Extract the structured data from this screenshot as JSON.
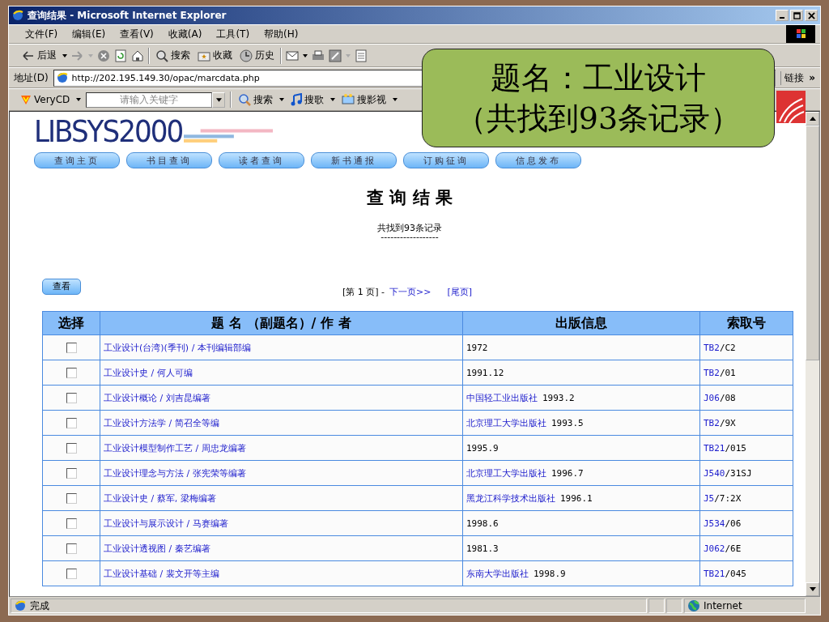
{
  "window": {
    "title": "查询结果 - Microsoft Internet Explorer"
  },
  "menu": [
    "文件(F)",
    "编辑(E)",
    "查看(V)",
    "收藏(A)",
    "工具(T)",
    "帮助(H)"
  ],
  "toolbar": {
    "back": "后退",
    "search": "搜索",
    "favorites": "收藏",
    "history": "历史"
  },
  "address": {
    "label": "地址(D)",
    "value": "http://202.195.149.30/opac/marcdata.php",
    "links": "链接",
    "more": "»"
  },
  "verycd": {
    "brand": "VeryCD",
    "placeholder": "请输入关键字",
    "search": "搜索",
    "music": "搜歌",
    "video": "搜影视"
  },
  "callout": {
    "line_1": "题名：工业设计",
    "line_2": "（共找到93条记录）"
  },
  "site": {
    "logo": "LIBSYS2000",
    "nav": [
      "查询主页",
      "书目查询",
      "读者查询",
      "新书通报",
      "订购征询",
      "信息发布"
    ]
  },
  "heading": "查 询 结 果",
  "count": "共找到93条记录",
  "rule": "------------------",
  "view_button": "查看",
  "pager": {
    "current": "[第 1 页] -",
    "next": "下一页>>",
    "last": "[尾页]"
  },
  "table": {
    "columns": [
      "选择",
      "题 名 （副题名）/ 作 者",
      "出版信息",
      "索取号"
    ],
    "rows": [
      {
        "checked": false,
        "title": "工业设计(台湾)(季刊) / 本刊编辑部编",
        "publisher": "",
        "year": "1972",
        "call_class": "TB2",
        "call_rest": "/C2"
      },
      {
        "checked": false,
        "title": "工业设计史 / 何人可编",
        "publisher": "",
        "year": "1991.12",
        "call_class": "TB2",
        "call_rest": "/01"
      },
      {
        "checked": false,
        "title": "工业设计概论 / 刘吉昆编著",
        "publisher": "中国轻工业出版社",
        "year": "1993.2",
        "call_class": "J06",
        "call_rest": "/08"
      },
      {
        "checked": false,
        "title": "工业设计方法学 / 简召全等编",
        "publisher": "北京理工大学出版社",
        "year": "1993.5",
        "call_class": "TB2",
        "call_rest": "/9X"
      },
      {
        "checked": false,
        "title": "工业设计模型制作工艺 / 周忠龙编著",
        "publisher": "",
        "year": "1995.9",
        "call_class": "TB21",
        "call_rest": "/015"
      },
      {
        "checked": false,
        "title": "工业设计理念与方法 / 张宪荣等编著",
        "publisher": "北京理工大学出版社",
        "year": "1996.7",
        "call_class": "J540",
        "call_rest": "/31SJ"
      },
      {
        "checked": false,
        "title": "工业设计史 / 蔡军, 梁梅编著",
        "publisher": "黑龙江科学技术出版社",
        "year": "1996.1",
        "call_class": "J5",
        "call_rest": "/7:2X"
      },
      {
        "checked": false,
        "title": "工业设计与展示设计 / 马赛编著",
        "publisher": "",
        "year": "1998.6",
        "call_class": "J534",
        "call_rest": "/06"
      },
      {
        "checked": false,
        "title": "工业设计透视图 / 秦艺编著",
        "publisher": "",
        "year": "1981.3",
        "call_class": "J062",
        "call_rest": "/6E"
      },
      {
        "checked": false,
        "title": "工业设计基础 / 裴文开等主编",
        "publisher": "东南大学出版社",
        "year": "1998.9",
        "call_class": "TB21",
        "call_rest": "/045"
      }
    ]
  },
  "status": {
    "text": "完成",
    "zone": "Internet"
  }
}
